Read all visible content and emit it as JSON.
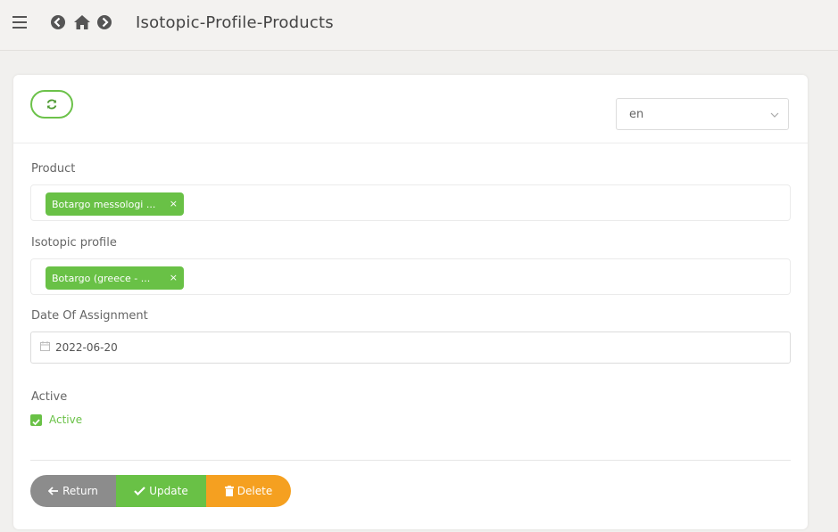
{
  "header": {
    "title": "Isotopic-Profile-Products",
    "icons": [
      "menu-icon",
      "back-icon",
      "home-icon",
      "forward-icon"
    ]
  },
  "toolbar": {
    "refresh_icon": "refresh-icon",
    "language": {
      "value": "en"
    }
  },
  "form": {
    "product": {
      "label": "Product",
      "tag": "Botargo messologi ...",
      "remove": "×"
    },
    "isotopic_profile": {
      "label": "Isotopic profile",
      "tag": "Botargo (greece - ...",
      "remove": "×"
    },
    "date": {
      "label": "Date Of Assignment",
      "value": "2022-06-20"
    },
    "active": {
      "label": "Active",
      "checkbox_label": "Active",
      "checked": true
    }
  },
  "actions": {
    "return_label": "Return",
    "update_label": "Update",
    "delete_label": "Delete"
  },
  "colors": {
    "accent_green": "#69c146",
    "gray": "#8c8c8c",
    "orange": "#f5a020"
  }
}
